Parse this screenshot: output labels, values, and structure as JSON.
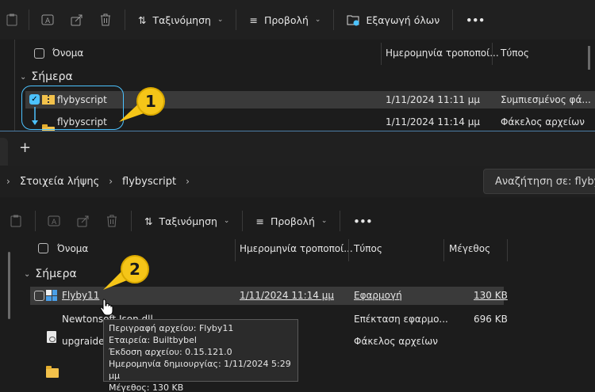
{
  "top": {
    "toolbar": {
      "sort_label": "Ταξινόμηση",
      "view_label": "Προβολή",
      "extract_label": "Εξαγωγή όλων",
      "more_label": "•••"
    },
    "columns": {
      "name": "Όνομα",
      "date": "Ημερομηνία τροποποί...",
      "type": "Τύπος"
    },
    "group_label": "Σήμερα",
    "rows": [
      {
        "name": "flybyscript",
        "date": "1/11/2024 11:11 μμ",
        "type": "Συμπιεσμένος φά..."
      },
      {
        "name": "flybyscript",
        "date": "1/11/2024 11:14 μμ",
        "type": "Φάκελος αρχείων"
      }
    ],
    "callout": "1"
  },
  "tabbar": {
    "new_tab": "+"
  },
  "address": {
    "crumbs": [
      "Στοιχεία λήψης",
      "flybyscript"
    ],
    "search_placeholder": "Αναζήτηση σε: flybys"
  },
  "bottom": {
    "toolbar": {
      "sort_label": "Ταξινόμηση",
      "view_label": "Προβολή",
      "more_label": "•••"
    },
    "columns": {
      "name": "Όνομα",
      "date": "Ημερομηνία τροποποί...",
      "type": "Τύπος",
      "size": "Μέγεθος"
    },
    "group_label": "Σήμερα",
    "rows": [
      {
        "name": "Flyby11",
        "date": "1/11/2024 11:14 μμ",
        "type": "Εφαρμογή",
        "size": "130 KB"
      },
      {
        "name": "Newtonsoft.Json.dll",
        "date": "",
        "type": "Επέκταση εφαρμο...",
        "size": "696 KB"
      },
      {
        "name": "upgraider",
        "date": "",
        "type": "Φάκελος αρχείων",
        "size": ""
      }
    ],
    "callout": "2",
    "tooltip": [
      "Περιγραφή αρχείου: Flyby11",
      "Εταιρεία: Builtbybel",
      "Έκδοση αρχείου: 0.15.121.0",
      "Ημερομηνία δημιουργίας: 1/11/2024 5:29 μμ",
      "Μέγεθος: 130 KB"
    ]
  },
  "colors": {
    "accent": "#4cc2ff",
    "callout": "#f5c518",
    "highlight": "#3a3a3a"
  }
}
